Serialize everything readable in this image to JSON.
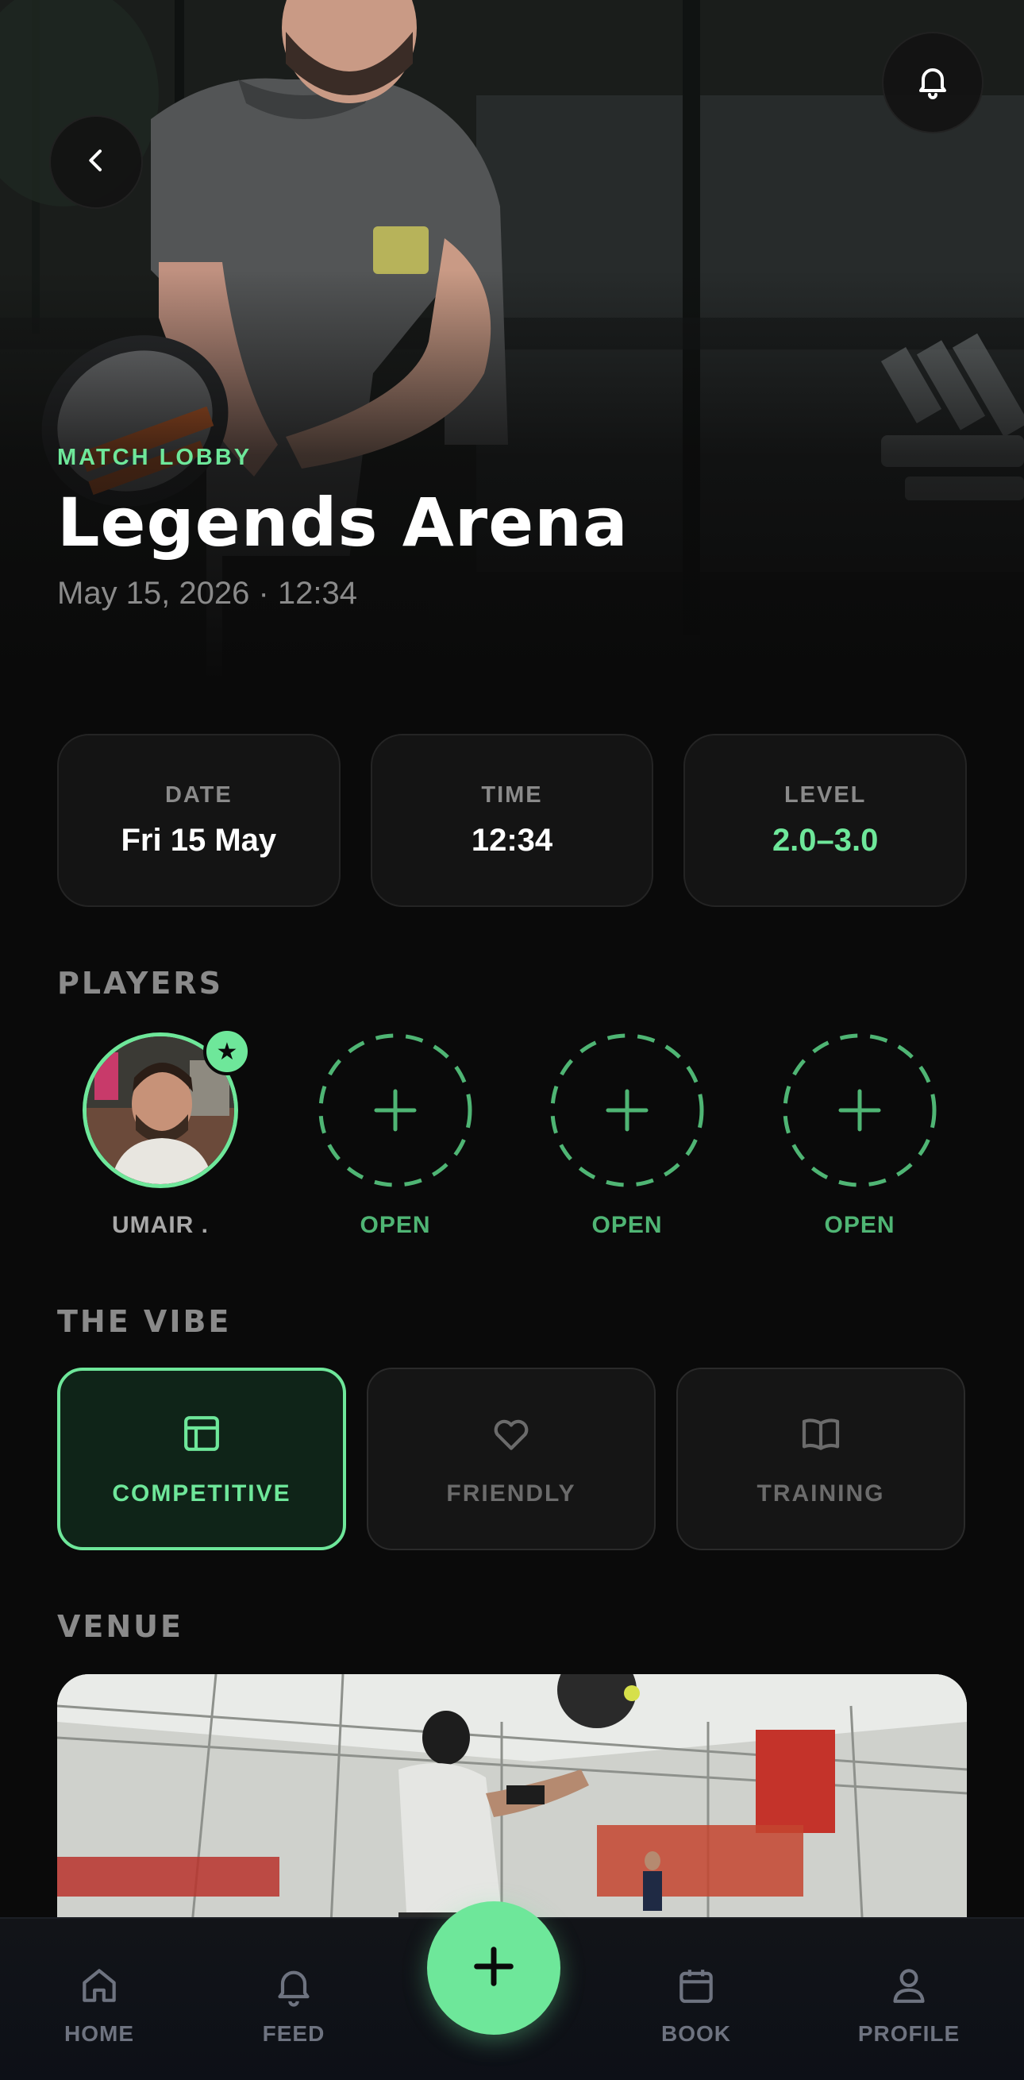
{
  "header": {
    "eyebrow": "MATCH LOBBY",
    "title": "Legends Arena",
    "subtitle": "May 15, 2026 · 12:34",
    "back_icon": "chevron-left-icon",
    "notification_icon": "bell-icon"
  },
  "info_cards": [
    {
      "label": "DATE",
      "value": "Fri 15 May"
    },
    {
      "label": "TIME",
      "value": "12:34"
    },
    {
      "label": "LEVEL",
      "value": "2.0–3.0"
    }
  ],
  "players": {
    "heading": "PLAYERS",
    "host": {
      "name": "UMAIR .",
      "badge_icon": "star-icon"
    },
    "open_slots": [
      {
        "label": "OPEN",
        "icon": "plus-icon"
      },
      {
        "label": "OPEN",
        "icon": "plus-icon"
      },
      {
        "label": "OPEN",
        "icon": "plus-icon"
      }
    ]
  },
  "vibe": {
    "heading": "THE VIBE",
    "options": [
      {
        "label": "COMPETITIVE",
        "icon": "layout-icon",
        "selected": true
      },
      {
        "label": "FRIENDLY",
        "icon": "heart-icon",
        "selected": false
      },
      {
        "label": "TRAINING",
        "icon": "book-icon",
        "selected": false
      }
    ]
  },
  "venue": {
    "heading": "VENUE"
  },
  "nav": {
    "items": [
      {
        "label": "HOME",
        "icon": "home-icon"
      },
      {
        "label": "FEED",
        "icon": "bell-icon"
      },
      {
        "label": "BOOK",
        "icon": "calendar-icon"
      },
      {
        "label": "PROFILE",
        "icon": "user-icon"
      }
    ],
    "fab_icon": "plus-icon"
  },
  "colors": {
    "accent": "#6ee79a",
    "background": "#0a0a0a",
    "card": "#141414",
    "muted": "#8a8a8a"
  }
}
